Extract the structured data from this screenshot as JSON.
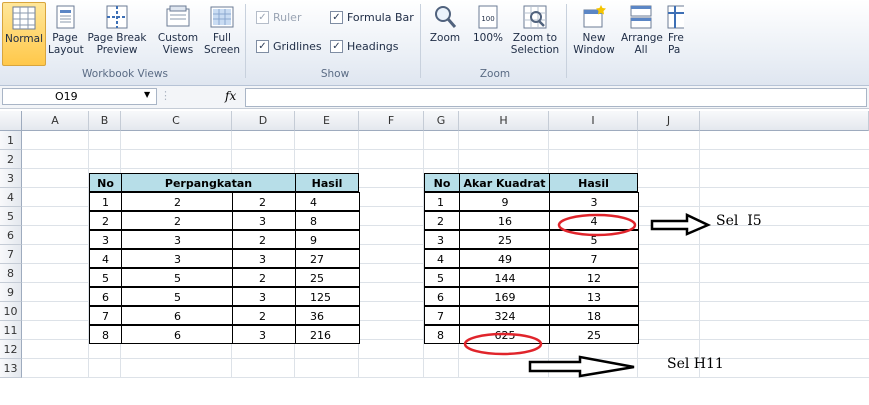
{
  "ribbon": {
    "workbook_views": {
      "group_label": "Workbook Views",
      "buttons": [
        {
          "label": "Normal",
          "active": true
        },
        {
          "label": "Page Layout"
        },
        {
          "label": "Page Break Preview"
        },
        {
          "label": "Custom Views"
        },
        {
          "label": "Full Screen"
        }
      ]
    },
    "show": {
      "group_label": "Show",
      "ruler": "Ruler",
      "formula_bar": "Formula Bar",
      "gridlines": "Gridlines",
      "headings": "Headings"
    },
    "zoom": {
      "group_label": "Zoom",
      "zoom": "Zoom",
      "hundred": "100%",
      "zoom_to_selection": "Zoom to Selection"
    },
    "window": {
      "new_window": "New Window",
      "arrange_all": "Arrange All",
      "freeze": "Fre Pa"
    }
  },
  "formula_bar": {
    "name_box": "O19",
    "fx": "fx",
    "formula": ""
  },
  "columns": [
    "A",
    "B",
    "C",
    "D",
    "E",
    "F",
    "G",
    "H",
    "I",
    "J"
  ],
  "rows": [
    "1",
    "2",
    "3",
    "4",
    "5",
    "6",
    "7",
    "8",
    "9",
    "10",
    "11",
    "12",
    "13"
  ],
  "table1": {
    "headers": {
      "no": "No",
      "perpangkatan": "Perpangkatan",
      "hasil": "Hasil"
    },
    "rows": [
      [
        "1",
        "2",
        "2",
        "4"
      ],
      [
        "2",
        "2",
        "3",
        "8"
      ],
      [
        "3",
        "3",
        "2",
        "9"
      ],
      [
        "4",
        "3",
        "3",
        "27"
      ],
      [
        "5",
        "5",
        "2",
        "25"
      ],
      [
        "6",
        "5",
        "3",
        "125"
      ],
      [
        "7",
        "6",
        "2",
        "36"
      ],
      [
        "8",
        "6",
        "3",
        "216"
      ]
    ]
  },
  "table2": {
    "headers": {
      "no": "No",
      "akar": "Akar Kuadrat",
      "hasil": "Hasil"
    },
    "rows": [
      [
        "1",
        "9",
        "3"
      ],
      [
        "2",
        "16",
        "4"
      ],
      [
        "3",
        "25",
        "5"
      ],
      [
        "4",
        "49",
        "7"
      ],
      [
        "5",
        "144",
        "12"
      ],
      [
        "6",
        "169",
        "13"
      ],
      [
        "7",
        "324",
        "18"
      ],
      [
        "8",
        "625",
        "25"
      ]
    ]
  },
  "annotations": {
    "i5": "Sel  I5",
    "h11": "Sel H11",
    "circle_color": "#e0242b"
  }
}
